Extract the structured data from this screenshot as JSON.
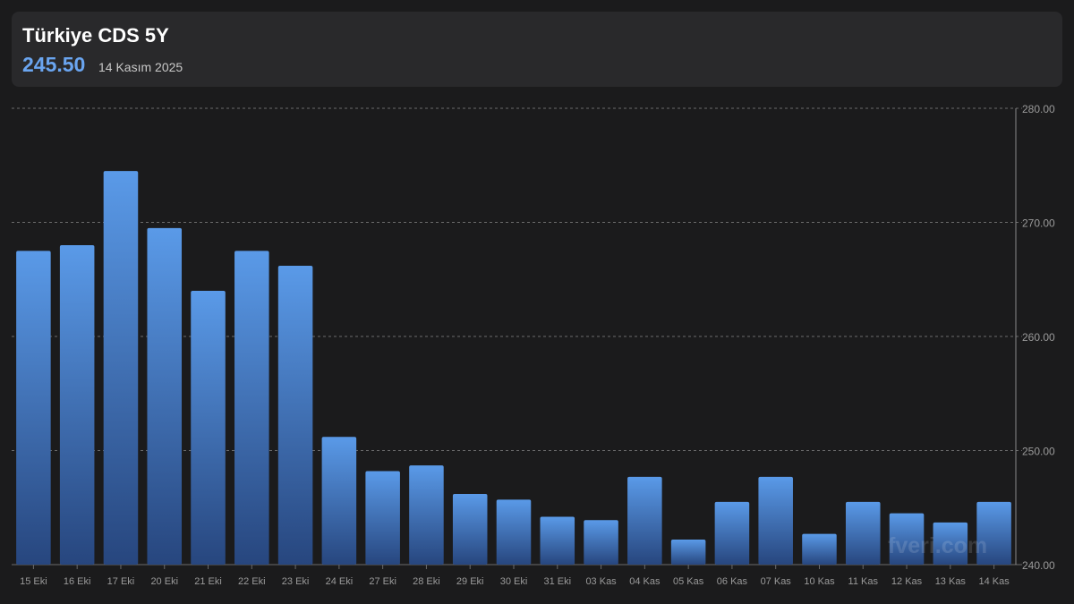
{
  "header": {
    "title": "Türkiye CDS 5Y",
    "value": "245.50",
    "date": "14 Kasım 2025"
  },
  "watermark": "fveri.com",
  "colors": {
    "background": "#1b1b1c",
    "panel": "#29292b",
    "accent": "#6aa5f0",
    "bar_top": "#5a9ae8",
    "bar_bottom": "#27467e"
  },
  "chart_data": {
    "type": "bar",
    "categories": [
      "15 Eki",
      "16 Eki",
      "17 Eki",
      "20 Eki",
      "21 Eki",
      "22 Eki",
      "23 Eki",
      "24 Eki",
      "27 Eki",
      "28 Eki",
      "29 Eki",
      "30 Eki",
      "31 Eki",
      "03 Kas",
      "04 Kas",
      "05 Kas",
      "06 Kas",
      "07 Kas",
      "10 Kas",
      "11 Kas",
      "12 Kas",
      "13 Kas",
      "14 Kas"
    ],
    "values": [
      267.5,
      268.0,
      274.5,
      269.5,
      264.0,
      267.5,
      266.2,
      251.2,
      248.2,
      248.7,
      246.2,
      245.7,
      244.2,
      243.9,
      247.7,
      242.2,
      245.5,
      247.7,
      242.7,
      245.5,
      244.5,
      243.7,
      245.5
    ],
    "ylim": [
      240,
      280
    ],
    "yticks": [
      "240.00",
      "250.00",
      "260.00",
      "270.00",
      "280.00"
    ],
    "y_axis_position": "right",
    "grid": true
  }
}
